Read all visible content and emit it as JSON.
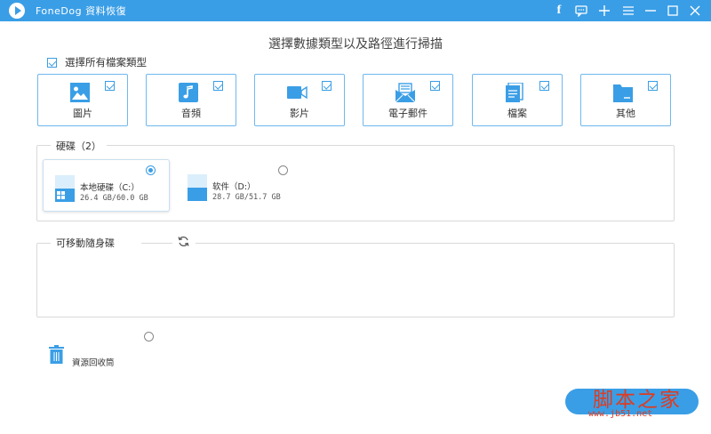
{
  "window": {
    "title": "FoneDog 資料恢復"
  },
  "page": {
    "title": "選擇數據類型以及路徑進行掃描"
  },
  "select_all": {
    "label": "選擇所有檔案類型",
    "checked": true
  },
  "file_types": [
    {
      "label": "圖片",
      "icon": "image-icon",
      "checked": true
    },
    {
      "label": "音頻",
      "icon": "music-icon",
      "checked": true
    },
    {
      "label": "影片",
      "icon": "video-icon",
      "checked": true
    },
    {
      "label": "電子郵件",
      "icon": "email-icon",
      "checked": true
    },
    {
      "label": "檔案",
      "icon": "document-icon",
      "checked": true
    },
    {
      "label": "其他",
      "icon": "folder-icon",
      "checked": true
    }
  ],
  "hard_drives": {
    "title": "硬碟（2）",
    "drives": [
      {
        "name": "本地硬碟（C:）",
        "size": "26.4 GB/60.0 GB",
        "selected": true,
        "icon": "windows-drive-icon"
      },
      {
        "name": "软件（D:）",
        "size": "28.7 GB/51.7 GB",
        "selected": false,
        "icon": "drive-icon"
      }
    ]
  },
  "removable": {
    "title": "可移動隨身碟"
  },
  "recycle_bin": {
    "label": "資源回收筒",
    "selected": false
  },
  "watermark": {
    "main": "脚本之家",
    "url": "www.jb51.net"
  },
  "colors": {
    "accent": "#3a9ee6",
    "watermark": "#e03b20"
  }
}
